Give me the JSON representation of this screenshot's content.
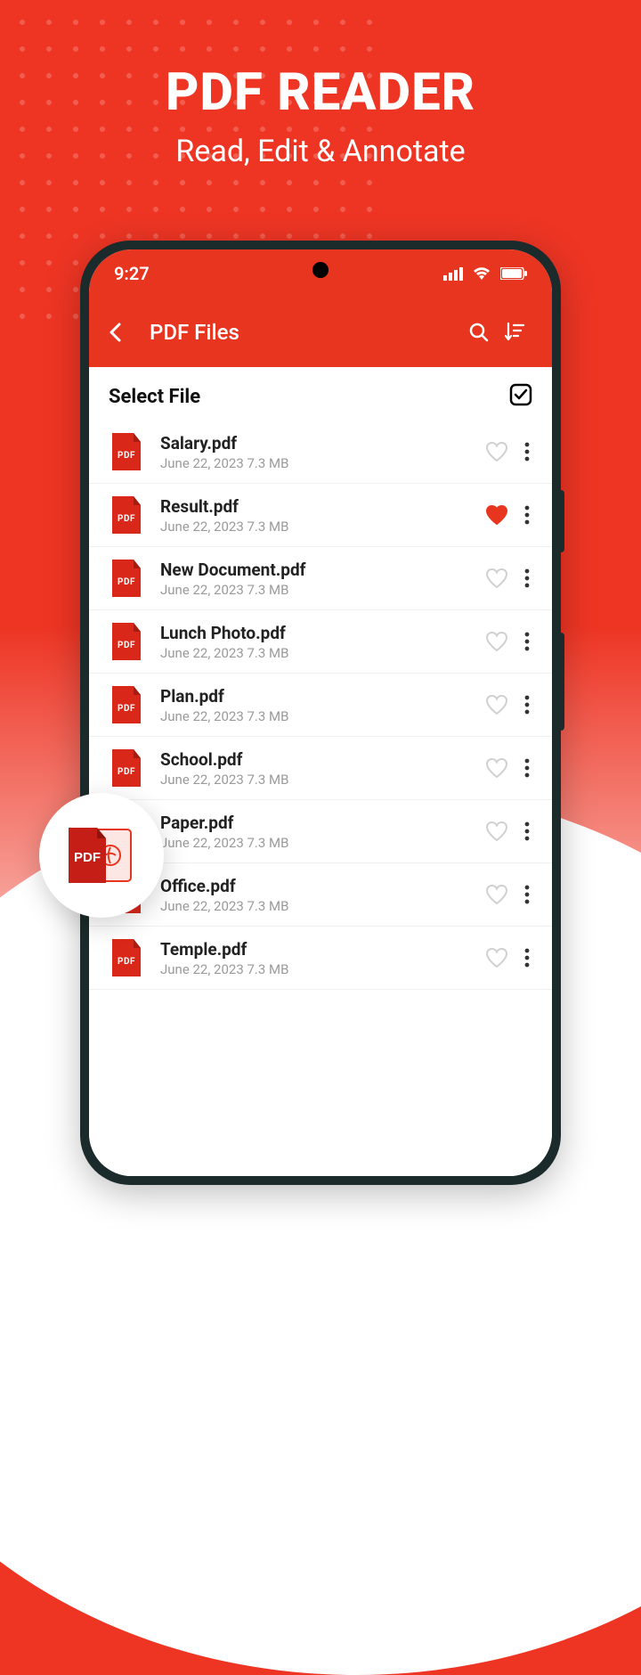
{
  "promo": {
    "title": "PDF READER",
    "subtitle": "Read, Edit & Annotate"
  },
  "statusbar": {
    "time": "9:27"
  },
  "header": {
    "title": "PDF Files"
  },
  "section": {
    "label": "Select File"
  },
  "icon_badge": "PDF",
  "files": [
    {
      "name": "Salary.pdf",
      "meta": "June 22, 2023 7.3 MB",
      "favorited": false
    },
    {
      "name": "Result.pdf",
      "meta": "June 22, 2023 7.3 MB",
      "favorited": true
    },
    {
      "name": "New Document.pdf",
      "meta": "June 22, 2023 7.3 MB",
      "favorited": false
    },
    {
      "name": "Lunch Photo.pdf",
      "meta": "June 22, 2023 7.3 MB",
      "favorited": false
    },
    {
      "name": "Plan.pdf",
      "meta": "June 22, 2023 7.3 MB",
      "favorited": false
    },
    {
      "name": "School.pdf",
      "meta": "June 22, 2023 7.3 MB",
      "favorited": false
    },
    {
      "name": "Paper.pdf",
      "meta": "June 22, 2023 7.3 MB",
      "favorited": false
    },
    {
      "name": "Office.pdf",
      "meta": "June 22, 2023 7.3 MB",
      "favorited": false
    },
    {
      "name": "Temple.pdf",
      "meta": "June 22, 2023 7.3 MB",
      "favorited": false
    }
  ],
  "badge_label": "PDF"
}
